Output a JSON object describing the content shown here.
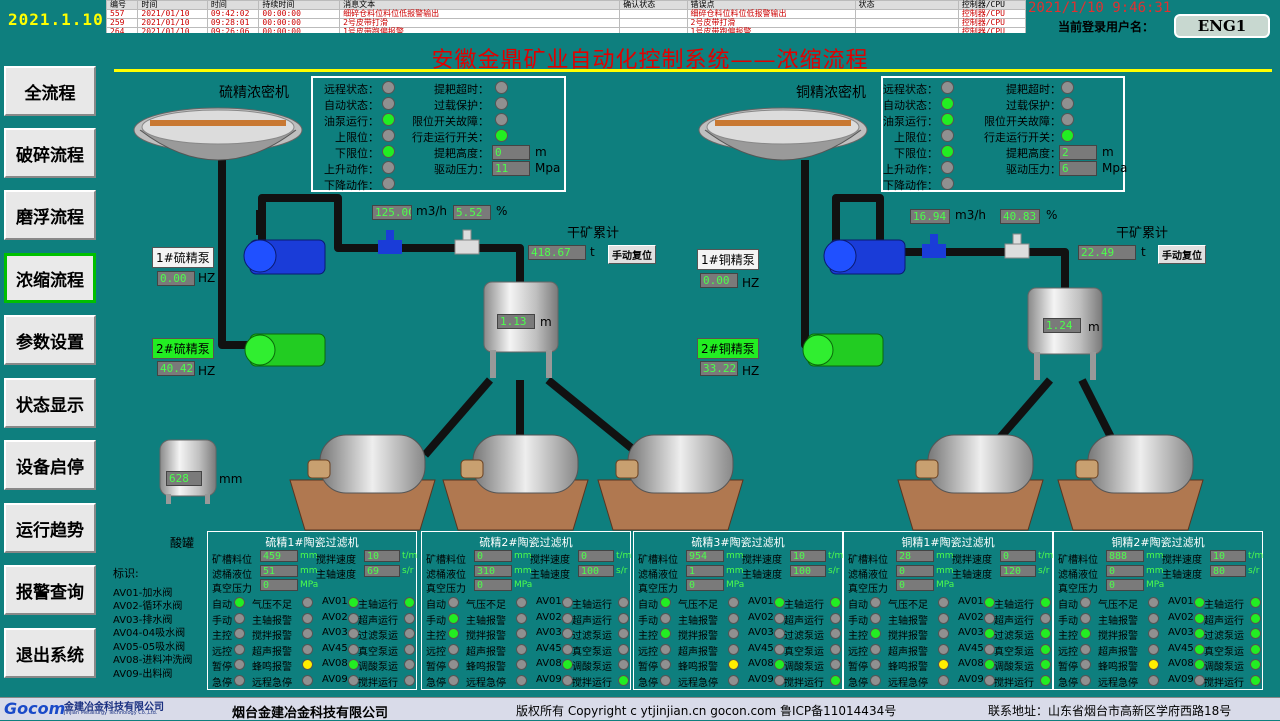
{
  "clock": "2021.1.10",
  "nav": [
    "全流程",
    "破碎流程",
    "磨浮流程",
    "浓缩流程",
    "参数设置",
    "状态显示",
    "设备启停",
    "运行趋势",
    "报警查询",
    "退出系统"
  ],
  "alarm": {
    "headers": [
      "编号",
      "时间",
      "时间",
      "持续时间",
      "消息文本",
      "确认状态",
      "错误点",
      "状态",
      "控制器/CPU"
    ],
    "rows": [
      [
        "557",
        "2021/01/10",
        "09:42:02",
        "00:00:00",
        "细碎仓料位料位低报警输出",
        "",
        "细碎仓料位料位低报警输出",
        "",
        "控制器/CPU"
      ],
      [
        "259",
        "2021/01/10",
        "09:28:01",
        "00:00:00",
        "2号皮带打滑",
        "",
        "2号皮带打滑",
        "",
        "控制器/CPU"
      ],
      [
        "264",
        "2021/01/10",
        "09:26:06",
        "00:00:00",
        "1号皮带跑偏报警",
        "",
        "1号皮带跑偏报警",
        "",
        "控制器/CPU"
      ]
    ]
  },
  "datetime": "2021/1/10 9:46:31",
  "user": {
    "label": "当前登录用户名：",
    "name": "ENG1"
  },
  "title": "安徽金鼎矿业自动化控制系统——浓缩流程",
  "left": {
    "thickener": "硫精浓密机",
    "status": {
      "remote": "远程状态：",
      "auto": "自动状态：",
      "oilpump": "油泵运行：",
      "uplimit": "上限位：",
      "downlimit": "下限位：",
      "rising": "上升动作：",
      "falling": "下降动作：",
      "rakeover": "提耙超时：",
      "overload": "过载保护：",
      "limitfault": "限位开关故障：",
      "travel": "行走运行开关：",
      "rakeheight": "提耙高度：",
      "drivepress": "驱动压力：",
      "rakeheight_v": "0",
      "drivepress_v": "11",
      "unit_m": "m",
      "unit_mpa": "Mpa"
    },
    "flow": "125.00",
    "flowunit": "m3/h",
    "pct": "5.52",
    "pctunit": "%",
    "dry": "干矿累计",
    "dry_v": "418.67",
    "dry_u": "t",
    "reset": "手动复位",
    "pump1": "1#硫精泵",
    "pump1_v": "0.00",
    "pump2": "2#硫精泵",
    "pump2_v": "40.42",
    "hz": "HZ",
    "tank": "1.13",
    "tank_u": "m",
    "acid": "628",
    "acid_u": "mm",
    "acid_lbl": "酸罐"
  },
  "right": {
    "thickener": "铜精浓密机",
    "status": {
      "remote": "远程状态：",
      "auto": "自动状态：",
      "oilpump": "油泵运行：",
      "uplimit": "上限位：",
      "downlimit": "下限位：",
      "rising": "上升动作：",
      "falling": "下降动作：",
      "rakeover": "提耙超时：",
      "overload": "过载保护：",
      "limitfault": "限位开关故障：",
      "travel": "行走运行开关：",
      "rakeheight": "提耙高度：",
      "drivepress": "驱动压力：",
      "rakeheight_v": "2",
      "drivepress_v": "6",
      "unit_m": "m",
      "unit_mpa": "Mpa"
    },
    "flow": "16.94",
    "flowunit": "m3/h",
    "pct": "40.83",
    "pctunit": "%",
    "dry": "干矿累计",
    "dry_v": "22.49",
    "dry_u": "t",
    "reset": "手动复位",
    "pump1": "1#铜精泵",
    "pump1_v": "0.00",
    "pump2": "2#铜精泵",
    "pump2_v": "33.22",
    "hz": "HZ",
    "tank": "1.24",
    "tank_u": "m"
  },
  "legend": {
    "title": "标识:",
    "items": [
      "AV01-加水阀",
      "AV02-循环水阀",
      "AV03-排水阀",
      "AV04-04吸水阀",
      "AV05-05吸水阀",
      "AV08-进料冲洗阀",
      "AV09-出料阀"
    ]
  },
  "filters": [
    {
      "title": "硫精1#陶瓷过滤机",
      "lvl": "459",
      "liq": "51",
      "vac": "0",
      "stir": "10",
      "spd": "69"
    },
    {
      "title": "硫精2#陶瓷过滤机",
      "lvl": "0",
      "liq": "310",
      "vac": "0",
      "stir": "0",
      "spd": "100"
    },
    {
      "title": "硫精3#陶瓷过滤机",
      "lvl": "954",
      "liq": "1",
      "vac": "0",
      "stir": "10",
      "spd": "100"
    },
    {
      "title": "铜精1#陶瓷过滤机",
      "lvl": "28",
      "liq": "0",
      "vac": "0",
      "stir": "0",
      "spd": "120"
    },
    {
      "title": "铜精2#陶瓷过滤机",
      "lvl": "888",
      "liq": "0",
      "vac": "0",
      "stir": "10",
      "spd": "80"
    }
  ],
  "flabels": {
    "lvl": "矿槽料位",
    "liq": "滤桶液位",
    "vac": "真空压力",
    "stir": "搅拌速度",
    "spd": "主轴速度",
    "mm": "mm",
    "mpa": "MPa",
    "tm": "t/m",
    "sr": "s/r",
    "c1": [
      "自动",
      "手动",
      "主控",
      "远控",
      "暂停",
      "急停"
    ],
    "c2": [
      "气压不足",
      "主轴报警",
      "搅拌报警",
      "超声报警",
      "蜂鸣报警",
      "远程急停"
    ],
    "c3": [
      "AV01",
      "AV02",
      "AV03",
      "AV45",
      "AV08",
      "AV09"
    ],
    "c4": [
      "主轴运行",
      "超声运行",
      "过滤泵运",
      "真空泵运",
      "调酸泵运",
      "搅拌运行"
    ]
  },
  "footer": {
    "logo": "Gocom",
    "company_logo": "金建冶金科技有限公司",
    "company_en": "Jinjian Metallurgy Technology Co.,Ltd.",
    "company": "烟台金建冶金科技有限公司",
    "copy": "版权所有  Copyright c ytjinjian.cn  gocon.com  鲁ICP备11014434号",
    "addr": "联系地址：山东省烟台市高新区学府西路18号"
  }
}
